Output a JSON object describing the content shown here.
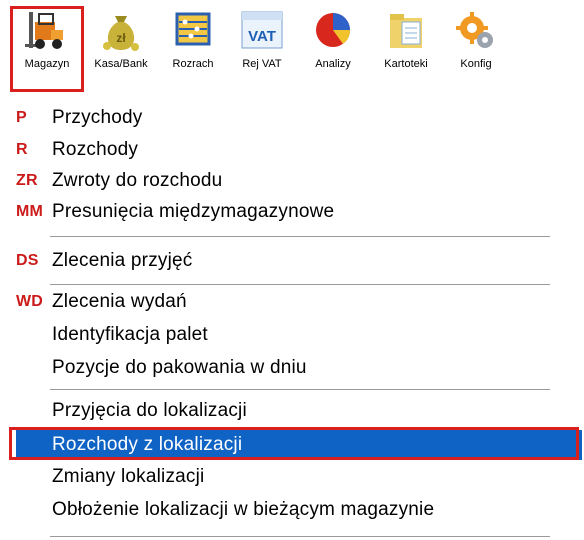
{
  "toolbar": {
    "buttons": [
      {
        "label": "Magazyn",
        "icon": "forklift-icon"
      },
      {
        "label": "Kasa/Bank",
        "icon": "money-bag-icon"
      },
      {
        "label": "Rozrach",
        "icon": "abacus-icon"
      },
      {
        "label": "Rej VAT",
        "icon": "vat-icon"
      },
      {
        "label": "Analizy",
        "icon": "pie-chart-icon"
      },
      {
        "label": "Kartoteki",
        "icon": "folder-icon"
      },
      {
        "label": "Konfig",
        "icon": "gears-icon"
      }
    ],
    "vat_text": "VAT"
  },
  "menu": {
    "items": [
      {
        "badge": "P",
        "label": "Przychody"
      },
      {
        "badge": "R",
        "label": "Rozchody"
      },
      {
        "badge": "ZR",
        "label": "Zwroty do rozchodu"
      },
      {
        "badge": "MM",
        "label": "Presunięcia międzymagazynowe"
      },
      {
        "badge": "DS",
        "label": "Zlecenia przyjęć"
      },
      {
        "badge": "WD",
        "label": "Zlecenia wydań"
      },
      {
        "badge": "",
        "label": "Identyfikacja palet"
      },
      {
        "badge": "",
        "label": "Pozycje do pakowania w dniu"
      },
      {
        "badge": "",
        "label": "Przyjęcia do lokalizacji"
      },
      {
        "badge": "",
        "label": "Rozchody z lokalizacji"
      },
      {
        "badge": "",
        "label": "Zmiany lokalizacji"
      },
      {
        "badge": "",
        "label": "Obłożenie lokalizacji w bieżącym magazynie"
      }
    ],
    "selected_index": 9
  },
  "colors": {
    "highlight": "#0f63c4",
    "accent_red": "#d9201e",
    "badge_red": "#cc1b1b"
  }
}
